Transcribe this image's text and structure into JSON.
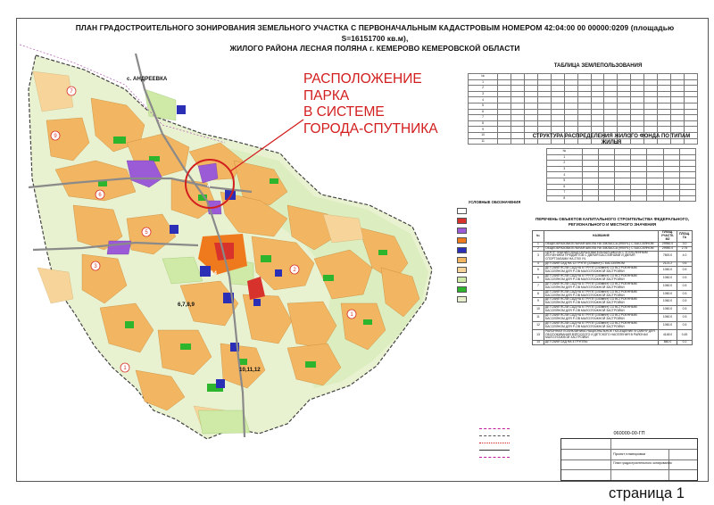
{
  "title": {
    "line1": "ПЛАН ГРАДОСТРОИТЕЛЬНОГО ЗОНИРОВАНИЯ ЗЕМЕЛЬНОГО УЧАСТКА С ПЕРВОНАЧАЛЬНЫМ  КАДАСТРОВЫМ НОМЕРОМ 42:04:00 00 00000:0209  (площадью S=16151700 кв.м),",
    "line2": "ЖИЛОГО РАЙОНА  ЛЕСНАЯ ПОЛЯНА  г. КЕМЕРОВО  КЕМЕРОВСКОЙ ОБЛАСТИ"
  },
  "callout": {
    "line1": "РАСПОЛОЖЕНИЕ",
    "line2": "ПАРКА",
    "line3": "В СИСТЕМЕ",
    "line4": "ГОРОДА-СПУТНИКА"
  },
  "map_labels": {
    "village": "с. АНДРЕЕВКА",
    "cluster1": "6,7,8,9",
    "cluster2": "10,11,12",
    "park_number": "4",
    "site_left": "14"
  },
  "colors": {
    "residential": "#f2b562",
    "residential_light": "#f7d59a",
    "green": "#2eb52e",
    "light_green": "#cfe9a6",
    "forest": "#e6f0cc",
    "purple": "#9b5bd6",
    "red": "#d8322c",
    "orange": "#ef7a1d",
    "blue": "#2b2fb5",
    "callout_red": "#d21e1e"
  },
  "tables": {
    "land_balance_title": "ТАБЛИЦА ЗЕМЛЕПОЛЬЗОВАНИЯ",
    "housing_title": "СТРУКТУРА РАСПРЕДЕЛЕНИЯ ЖИЛОГО ФОНДА ПО ТИПАМ ЖИЛЬЯ"
  },
  "legend": {
    "head": "УСЛОВНЫЕ ОБОЗНАЧЕНИЯ"
  },
  "objects": {
    "head": "ПЕРЕЧЕНЬ  ОБЪЕКТОВ КАПИТАЛЬНОГО СТРОИТЕЛЬСТВА ФЕДЕРАЛЬНОГО, РЕГИОНАЛЬНОГО И МЕСТНОГО ЗНАЧЕНИЯ",
    "col_no": "№",
    "col_name": "НАЗВАНИЕ",
    "col_area": "ПЛОЩ. УЧАСТК. М2",
    "col_level": "ПЛОЩ. ГА",
    "rows": [
      {
        "no": "1",
        "name": "ОБЩЕОБРАЗОВАТЕЛЬНАЯ ШКОЛА НА 33КЛАССА (990УЧ.) С БАССЕЙНОМ",
        "area": "29950.0",
        "ha": "3.0"
      },
      {
        "no": "2",
        "name": "ОБЩЕОБРАЗОВАТЕЛЬНАЯ ШКОЛА НА 33КЛАССА (990УЧ.) С БАССЕЙНОМ",
        "area": "29950.0",
        "ha": "2.75"
      },
      {
        "no": "3",
        "name": "ЦЕНТР ЗНАНИЙ ОБЩЕОБРАЗОВАТЕЛЬНАЯ ШКОЛА С УГЛУБЛЕННЫМ ИЗУЧЕНИЕМ ПРЕДМЕТОВ С ДВУМЯ БАССЕЙНАМИ И ДВУМЯ СПОРТЗАЛАМИ НА 2700 УЧ.",
        "area": "7800.0",
        "ha": "4.0"
      },
      {
        "no": "4",
        "name": "ДЕТСКИЙ САД НА 12 ГРУПП (220мест) С БАССЕЙНОМ",
        "area": "2121.2",
        "ha": "0.6"
      },
      {
        "no": "5",
        "name": "ДЕТСКИЙ ЯСЛИ-САД НА 6 ГРУПП (140мест) СО ВСТРОЕННЫМ БАССЕЙНОМ ДЛЯ Р-ОВ МАЛОЭТАЖНОЙ ЗАСТРОЙКИ",
        "area": "1060.0",
        "ha": "0.5"
      },
      {
        "no": "6",
        "name": "ДЕТСКИЙ ЯСЛИ-САД НА 6 ГРУПП (140мест) СО ВСТРОЕННЫМ БАССЕЙНОМ ДЛЯ Р-ОВ МАЛОЭТАЖНОЙ ЗАСТРОЙКИ",
        "area": "1060.0",
        "ha": "0.5"
      },
      {
        "no": "7",
        "name": "ДЕТСКИЙ ЯСЛИ-САД НА 6 ГРУПП (140мест) СО ВСТРОЕННЫМ БАССЕЙНОМ ДЛЯ Р-ОВ МАЛОЭТАЖНОЙ ЗАСТРОЙКИ",
        "area": "1060.0",
        "ha": "0.5"
      },
      {
        "no": "8",
        "name": "ДЕТСКИЙ ЯСЛИ-САД НА 6 ГРУПП (140мест) СО ВСТРОЕННЫМ БАССЕЙНОМ ДЛЯ Р-ОВ МАЛОЭТАЖНОЙ ЗАСТРОЙКИ",
        "area": "1060.0",
        "ha": "0.5"
      },
      {
        "no": "9",
        "name": "ДЕТСКИЙ ЯСЛИ-САД НА 6 ГРУПП (140мест) СО ВСТРОЕННЫМ БАССЕЙНОМ ДЛЯ Р-ОВ МАЛОЭТАЖНОЙ ЗАСТРОЙКИ",
        "area": "1060.0",
        "ha": "0.5"
      },
      {
        "no": "10",
        "name": "ДЕТСКИЙ ЯСЛИ-САД НА 6 ГРУПП (140мест) СО ВСТРОЕННЫМ БАССЕЙНОМ ДЛЯ Р-ОВ МАЛОЭТАЖНОЙ ЗАСТРОЙКИ",
        "area": "1060.0",
        "ha": "0.5"
      },
      {
        "no": "11",
        "name": "ДЕТСКИЙ ЯСЛИ-САД НА 6 ГРУПП (140мест) СО ВСТРОЕННЫМ БАССЕЙНОМ ДЛЯ Р-ОВ МАЛОЭТАЖНОЙ ЗАСТРОЙКИ",
        "area": "1060.0",
        "ha": "0.5"
      },
      {
        "no": "12",
        "name": "ДЕТСКИЙ ЯСЛИ-САД НА 6 ГРУПП (140мест) СО ВСТРОЕННЫМ БАССЕЙНОМ ДЛЯ Р-ОВ МАЛОЭТАЖНОЙ ЗАСТРОЙКИ",
        "area": "1060.0",
        "ha": "0.5"
      },
      {
        "no": "13",
        "name": "РАЙОННАЯ ПОЛИКЛИНИКА НАЦИОНАЛЬНОЕ ПОСЕЩЕНИЕ В СМЕНУ ДЛЯ ОБСЛУЖИВАНИЯ ВЗРОСЛОГО И ДЕТСКОГО НАСЕЛЕНИЯ В РАЙОНАХ МАЛОЭТАЖНОЙ ЗАСТРОЙКИ",
        "area": "4148.0",
        "ha": "0.45"
      },
      {
        "no": "14",
        "name": "ДЕТСКИЙ САД НА 4 ГРУППЫ",
        "area": "860.0",
        "ha": "0.2"
      }
    ]
  },
  "stamp": {
    "code": "060000-00-ГП",
    "project": "Проект планировки",
    "sheet_title": "План градостроительного зонирования"
  },
  "page_caption": "страница 1"
}
